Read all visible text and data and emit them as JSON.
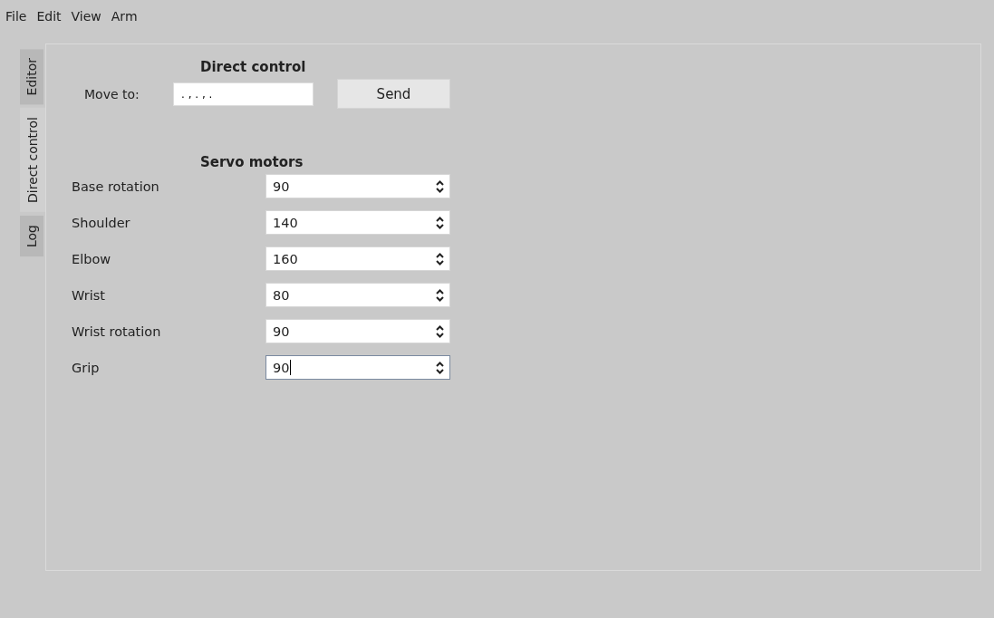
{
  "menu": [
    "File",
    "Edit",
    "View",
    "Arm"
  ],
  "tabs": [
    {
      "label": "Editor",
      "selected": false
    },
    {
      "label": "Direct control",
      "selected": true
    },
    {
      "label": "Log",
      "selected": false
    }
  ],
  "direct_control": {
    "title": "Direct control",
    "label": "Move to:",
    "value": ". , . , .",
    "button": "Send"
  },
  "servo_motors": {
    "title": "Servo motors",
    "servos": [
      {
        "name": "Base rotation",
        "value": "90",
        "focused": false
      },
      {
        "name": "Shoulder",
        "value": "140",
        "focused": false
      },
      {
        "name": "Elbow",
        "value": "160",
        "focused": false
      },
      {
        "name": "Wrist",
        "value": "80",
        "focused": false
      },
      {
        "name": "Wrist rotation",
        "value": "90",
        "focused": false
      },
      {
        "name": "Grip",
        "value": "90",
        "focused": true
      }
    ]
  }
}
